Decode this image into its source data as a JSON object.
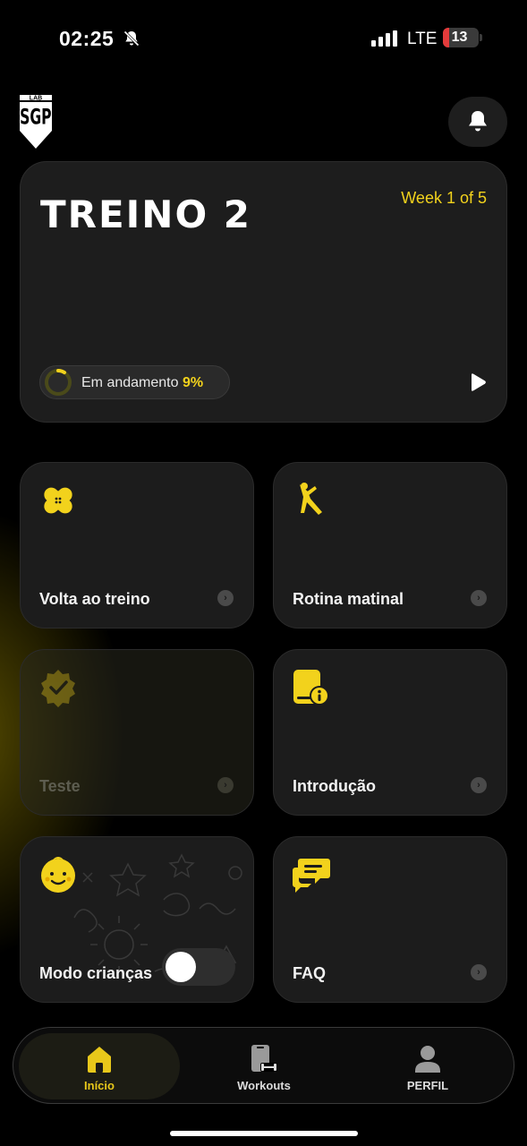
{
  "status_bar": {
    "time": "02:25",
    "network": "LTE",
    "battery_level": "13",
    "icons": [
      "bell-slash-icon",
      "signal-icon"
    ]
  },
  "header": {
    "logo_text_top": "LAB",
    "logo_text_main": "SGP",
    "notification_icon": "bell-icon"
  },
  "hero": {
    "title": "TREINO 2",
    "week": "Week 1 of 5",
    "status_label": "Em andamento",
    "progress_percent": "9%",
    "progress_value": 0.09,
    "play_icon": "play-icon"
  },
  "tiles": [
    {
      "label": "Volta ao treino",
      "icon": "bandage-icon",
      "enabled": true
    },
    {
      "label": "Rotina matinal",
      "icon": "stretching-person-icon",
      "enabled": true
    },
    {
      "label": "Teste",
      "icon": "verified-badge-icon",
      "enabled": false
    },
    {
      "label": "Introdução",
      "icon": "info-document-icon",
      "enabled": true
    },
    {
      "label": "Modo crianças",
      "icon": "baby-face-icon",
      "toggle_on": false
    },
    {
      "label": "FAQ",
      "icon": "chat-bubbles-icon",
      "enabled": true
    }
  ],
  "tab_bar": {
    "tabs": [
      {
        "label": "Início",
        "icon": "home-icon",
        "active": true
      },
      {
        "label": "Workouts",
        "icon": "workouts-icon",
        "active": false
      },
      {
        "label": "PERFIL",
        "icon": "profile-icon",
        "active": false
      }
    ]
  },
  "colors": {
    "accent": "#f2d21c",
    "card": "#1d1d1d",
    "background": "#000000"
  }
}
